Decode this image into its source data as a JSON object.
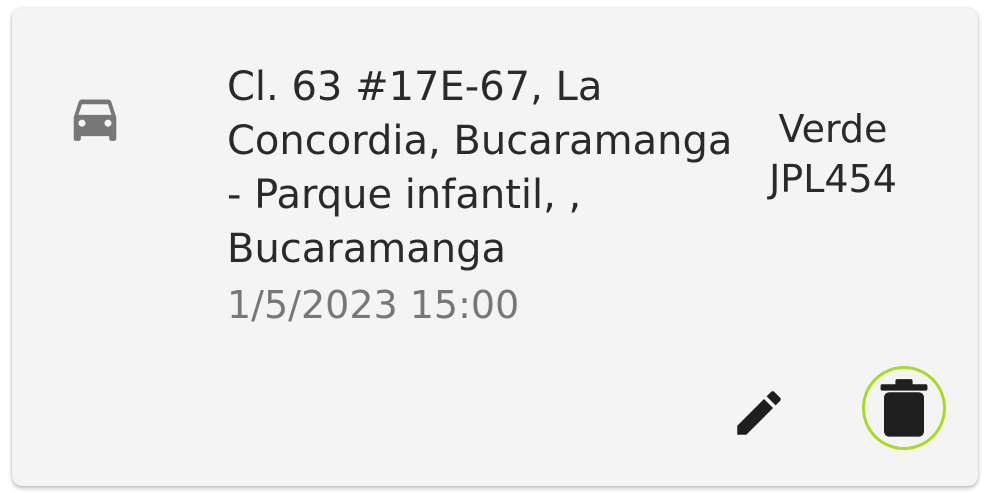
{
  "trip": {
    "address": "Cl. 63 #17E-67, La Concordia, Bucaramanga - Parque infantil, , Bucaramanga",
    "datetime": "1/5/2023 15:00",
    "vehicle_color": "Verde",
    "vehicle_plate": "JPL454",
    "icon": "car-icon"
  },
  "actions": {
    "edit_icon": "pencil-icon",
    "delete_icon": "trash-icon",
    "focus_ring_color": "#a6dd20"
  },
  "colors": {
    "card_background": "#f4f4f4",
    "primary_text": "#2a2a2a",
    "secondary_text": "#777777",
    "icon_gray": "#777777"
  }
}
